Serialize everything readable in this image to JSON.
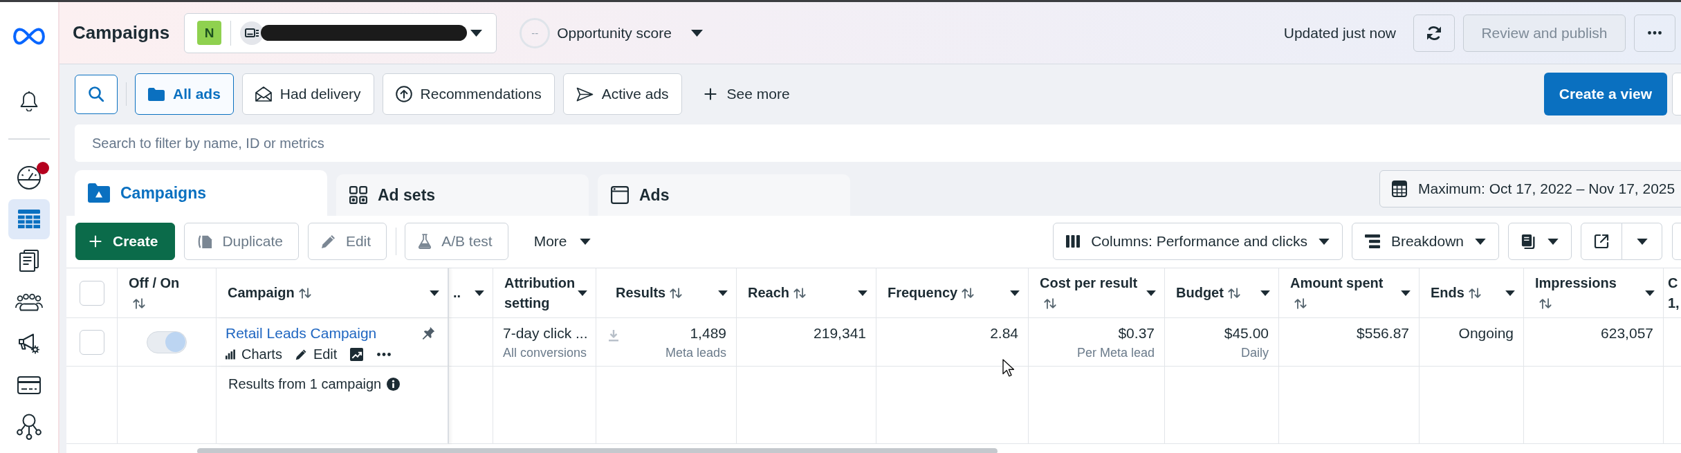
{
  "sidebar": {
    "top_items": [
      {
        "kind": "bell",
        "selected": false,
        "alert": false
      }
    ],
    "items": [
      {
        "kind": "gauge",
        "selected": false,
        "alert": true
      },
      {
        "kind": "table",
        "selected": true,
        "alert": false
      },
      {
        "kind": "documents",
        "selected": false,
        "alert": false
      },
      {
        "kind": "people",
        "selected": false,
        "alert": false
      },
      {
        "kind": "megaphone",
        "selected": false,
        "alert": false
      },
      {
        "kind": "card",
        "selected": false,
        "alert": false
      },
      {
        "kind": "network",
        "selected": false,
        "alert": false
      }
    ]
  },
  "header": {
    "title": "Campaigns",
    "account": {
      "initial": "N",
      "name_redacted": true
    },
    "opportunity": {
      "score": "--",
      "label": "Opportunity score"
    },
    "status": "Updated just now",
    "review_button": {
      "label": "Review and publish",
      "disabled": true
    }
  },
  "filters": {
    "items": [
      {
        "kind": "folder",
        "label": "All ads",
        "selected": true
      },
      {
        "kind": "envelope",
        "label": "Had delivery",
        "selected": false
      },
      {
        "kind": "arrow_circle",
        "label": "Recommendations",
        "selected": false
      },
      {
        "kind": "plane",
        "label": "Active ads",
        "selected": false
      }
    ],
    "see_more": "See more",
    "create_view": "Create a view"
  },
  "search": {
    "placeholder": "Search to filter by name, ID or metrics"
  },
  "level_tabs": [
    {
      "kind": "campaigns",
      "label": "Campaigns",
      "selected": true
    },
    {
      "kind": "ad_sets",
      "label": "Ad sets",
      "selected": false
    },
    {
      "kind": "ads",
      "label": "Ads",
      "selected": false
    }
  ],
  "date_range": "Maximum: Oct 17, 2022 – Nov 17, 2025",
  "toolbar": {
    "actions": [
      {
        "kind": "create",
        "label": "Create",
        "disabled": false
      },
      {
        "kind": "duplicate",
        "label": "Duplicate",
        "disabled": true
      },
      {
        "kind": "edit",
        "label": "Edit",
        "disabled": true
      },
      {
        "kind": "ab_test",
        "label": "A/B test",
        "disabled": true
      }
    ],
    "more": "More",
    "columns": "Columns: Performance and clicks",
    "breakdown": "Breakdown"
  },
  "table": {
    "all_checked": false,
    "columns": [
      {
        "kind": "toggle",
        "label": "Off / On",
        "sortable": true,
        "menu": false
      },
      {
        "kind": "name",
        "label": "Campaign",
        "sortable": true,
        "menu": true
      },
      {
        "kind": "clipped",
        "label": "..",
        "sortable": false,
        "menu": true
      },
      {
        "kind": "metric",
        "label": "Attribution setting",
        "sortable": false,
        "menu": true
      },
      {
        "kind": "metric",
        "label": "Results",
        "sortable": true,
        "menu": true
      },
      {
        "kind": "metric",
        "label": "Reach",
        "sortable": true,
        "menu": true
      },
      {
        "kind": "metric",
        "label": "Frequency",
        "sortable": true,
        "menu": true
      },
      {
        "kind": "metric",
        "label": "Cost per result",
        "sortable": true,
        "menu": true
      },
      {
        "kind": "metric",
        "label": "Budget",
        "sortable": true,
        "menu": true
      },
      {
        "kind": "metric",
        "label": "Amount spent",
        "sortable": true,
        "menu": true
      },
      {
        "kind": "metric",
        "label": "Ends",
        "sortable": true,
        "menu": true
      },
      {
        "kind": "metric",
        "label": "Impressions",
        "sortable": true,
        "menu": true
      },
      {
        "kind": "clipped",
        "label": "C 1,",
        "sortable": false,
        "menu": false
      }
    ],
    "rows": [
      {
        "checked": false,
        "cells": [
          {
            "kind": "toggle",
            "on": true
          },
          {
            "kind": "name",
            "name": "Retail Leads Campaign",
            "actions": [
              {
                "kind": "charts",
                "label": "Charts"
              },
              {
                "kind": "edit",
                "label": "Edit"
              }
            ]
          },
          "",
          {
            "kind": "setting",
            "value": "7-day click ...",
            "sub": "All conversions"
          },
          {
            "kind": "result",
            "value": "1,489",
            "sub": "Meta leads"
          },
          {
            "kind": "number",
            "value": "219,341"
          },
          {
            "kind": "number",
            "value": "2.84"
          },
          {
            "kind": "number",
            "value": "$0.37",
            "sub": "Per Meta lead"
          },
          {
            "kind": "number",
            "value": "$45.00",
            "sub": "Daily"
          },
          {
            "kind": "number",
            "value": "$556.87"
          },
          {
            "kind": "number",
            "value": "Ongoing"
          },
          {
            "kind": "number",
            "value": "623,057"
          },
          ""
        ]
      }
    ],
    "summary": "Results from 1 campaign"
  }
}
